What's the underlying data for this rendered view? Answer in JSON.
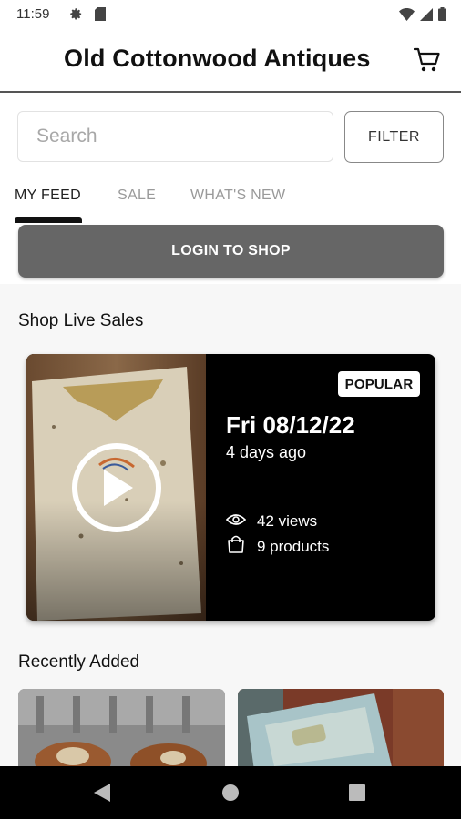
{
  "status_bar": {
    "time": "11:59",
    "icons": [
      "gear-icon",
      "sim-card-icon",
      "wifi-icon",
      "signal-icon",
      "battery-icon"
    ]
  },
  "app_bar": {
    "title": "Old Cottonwood Antiques",
    "cart_icon": "cart-icon"
  },
  "search": {
    "placeholder": "Search",
    "value": ""
  },
  "filter_button": {
    "label": "FILTER"
  },
  "tabs": [
    {
      "label": "MY FEED",
      "active": true
    },
    {
      "label": "SALE",
      "active": false
    },
    {
      "label": "WHAT'S NEW",
      "active": false
    }
  ],
  "login_button": {
    "label": "LOGIN TO SHOP"
  },
  "live_sales": {
    "section_title": "Shop Live Sales",
    "card": {
      "badge": "POPULAR",
      "date": "Fri 08/12/22",
      "relative_time": "4 days ago",
      "views": "42 views",
      "products": "9 products",
      "icons": [
        "play-icon",
        "eye-icon",
        "shopping-bag-icon"
      ]
    }
  },
  "recently_added": {
    "section_title": "Recently Added"
  },
  "nav_bar": {
    "icons": [
      "back-icon",
      "home-icon",
      "recents-icon"
    ]
  },
  "colors": {
    "login_button": "#666666",
    "card_background": "#000000",
    "nav_bar": "#000000"
  }
}
